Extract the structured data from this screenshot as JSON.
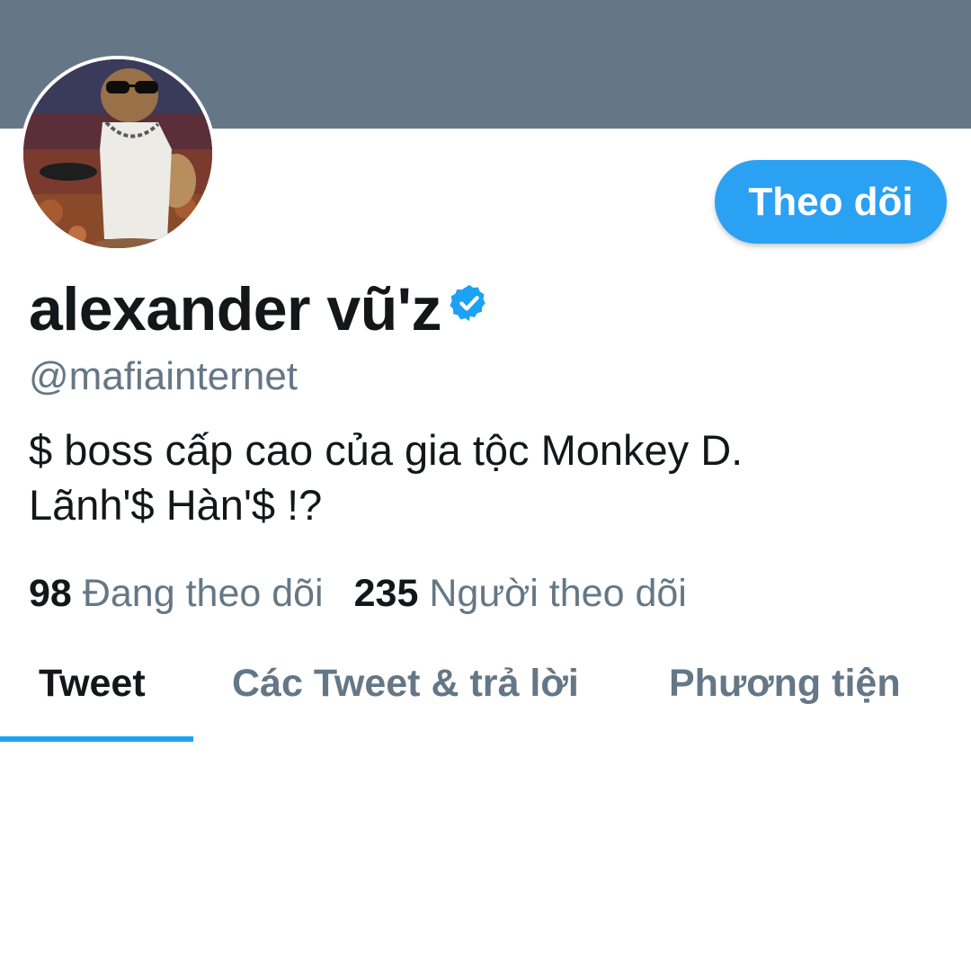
{
  "colors": {
    "banner": "#657786",
    "accent": "#1da1f2",
    "follow_button": "#2ba1f3",
    "primary_text": "#14171a",
    "secondary_text": "#657786"
  },
  "profile": {
    "display_name": "alexander vũ'z",
    "verified_icon": "verified-badge-icon",
    "handle": "@mafiainternet",
    "bio_line1": "$ boss cấp cao của gia tộc Monkey D.",
    "bio_line2": "Lãnh'$ Hàn'$ !?",
    "avatar": "avatar-photo"
  },
  "actions": {
    "follow_label": "Theo dõi"
  },
  "stats": {
    "following_count": "98",
    "following_label": "Đang theo dõi",
    "followers_count": "235",
    "followers_label": "Người theo dõi"
  },
  "tabs": [
    {
      "label": "Tweet",
      "active": true
    },
    {
      "label": "Các Tweet & trả lời",
      "active": false
    },
    {
      "label": "Phương tiện",
      "active": false
    }
  ]
}
